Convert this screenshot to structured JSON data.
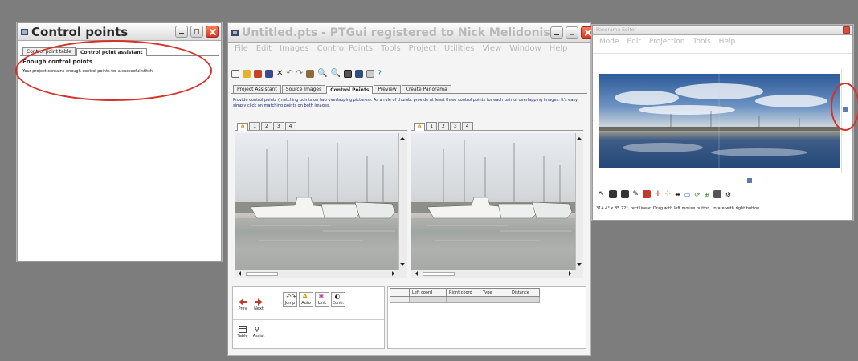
{
  "cp_window": {
    "title": "Control points",
    "tabs": [
      "Control point table",
      "Control point assistant"
    ],
    "heading": "Enough control points",
    "message": "Your project contains enough control points for a succesful stitch."
  },
  "main_window": {
    "title": "Untitled.pts - PTGui registered to Nick Melidonis",
    "menu": [
      "File",
      "Edit",
      "Images",
      "Control Points",
      "Tools",
      "Project",
      "Utilities",
      "View",
      "Window",
      "Help"
    ],
    "tabs": [
      "Project Assistant",
      "Source Images",
      "Control Points",
      "Preview",
      "Create Panorama"
    ],
    "active_tab": "Control Points",
    "instructions": "Provide control points (matching points on two overlapping pictures). As a rule of thumb, provide at least three control points for each pair of overlapping images. It's easy: simply click on matching points on both images.",
    "left_image_tabs": [
      "0",
      "1",
      "2",
      "3",
      "4"
    ],
    "right_image_tabs": [
      "0",
      "1",
      "2",
      "3",
      "4"
    ],
    "buttons": {
      "prev": "Prev",
      "next": "Next",
      "jump": "Jump",
      "auto": "Auto",
      "link": "Link",
      "cont": "Contr.",
      "table": "Table",
      "assist": "Assist"
    },
    "table_headers": [
      "Left coord",
      "Right coord",
      "Type",
      "Distance"
    ]
  },
  "pano_window": {
    "title": "Panorama Editor",
    "menu": [
      "Mode",
      "Edit",
      "Projection",
      "Tools",
      "Help"
    ],
    "status": "314.4° x 85.22°, rectilinear. Drag with left mouse button, rotate with right button"
  },
  "colors": {
    "background": "#7d7d7d",
    "annotation_red": "#d6322a",
    "close_button": "#d83a20"
  }
}
